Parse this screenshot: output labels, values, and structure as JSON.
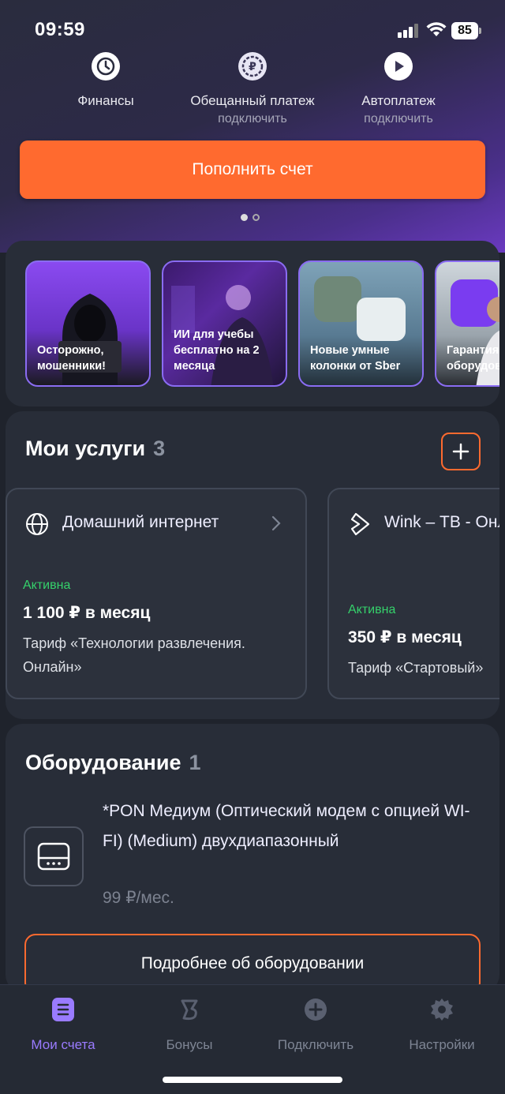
{
  "status": {
    "time": "09:59",
    "battery": "85"
  },
  "quick_actions": [
    {
      "label": "Финансы",
      "sub": "",
      "icon": "clock-icon"
    },
    {
      "label": "Обещанный платеж",
      "sub": "подключить",
      "icon": "ruble-circle-icon"
    },
    {
      "label": "Автоплатеж",
      "sub": "подключить",
      "icon": "play-icon"
    }
  ],
  "topup_label": "Пополнить счет",
  "stories": [
    {
      "caption": "Осторожно, мошенники!"
    },
    {
      "caption": "ИИ для учебы бесплатно на 2 месяца"
    },
    {
      "caption": "Новые умные колонки от Sber"
    },
    {
      "caption": "Гарантия на оборудование"
    }
  ],
  "services": {
    "title": "Мои услуги",
    "count": "3",
    "items": [
      {
        "name": "Домашний интернет",
        "status": "Активна",
        "price": "1 100 ₽ в месяц",
        "tariff": "Тариф «Технологии развлечения. Онлайн»",
        "icon": "globe-icon"
      },
      {
        "name": "Wink – ТВ - Онлайн",
        "status": "Активна",
        "price": "350 ₽ в месяц",
        "tariff": "Тариф «Стартовый»",
        "icon": "wink-icon"
      }
    ]
  },
  "equipment": {
    "title": "Оборудование",
    "count": "1",
    "name": "*PON Медиум (Оптический модем с опцией WI-FI) (Medium) двухдиапазонный",
    "price": "99 ₽/мес.",
    "button": "Подробнее об оборудовании"
  },
  "tabs": [
    {
      "label": "Мои счета",
      "icon": "accounts-icon",
      "active": true
    },
    {
      "label": "Бонусы",
      "icon": "bonus-icon",
      "active": false
    },
    {
      "label": "Подключить",
      "icon": "plus-circle-icon",
      "active": false
    },
    {
      "label": "Настройки",
      "icon": "gear-icon",
      "active": false
    }
  ],
  "colors": {
    "accent": "#ff6a2f",
    "active_tab": "#9a7bff",
    "status_active": "#35d16b"
  }
}
